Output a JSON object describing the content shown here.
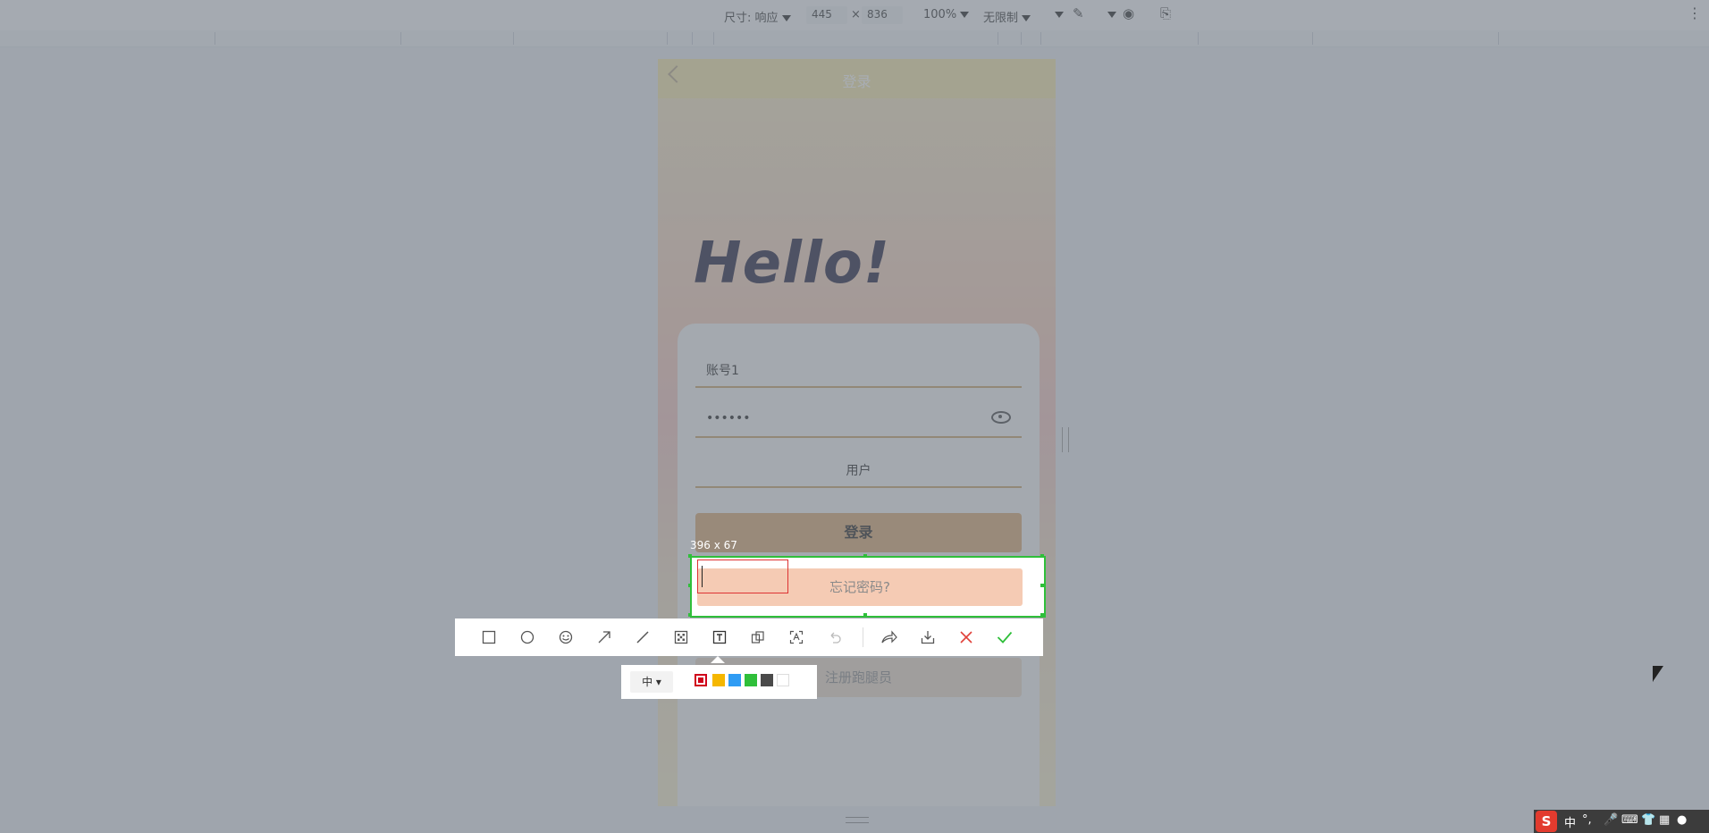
{
  "devtools": {
    "size_label": "尺寸: 响应",
    "width": "445",
    "times": "×",
    "height": "836",
    "zoom": "100%",
    "throttle": "无限制"
  },
  "app": {
    "nav_title": "登录",
    "hello": "Hello!",
    "account_value": "账号1",
    "password_value": "••••••",
    "role_value": "用户",
    "login_label": "登录",
    "forgot_label": "忘记密码?",
    "register_label": "注册跑腿员"
  },
  "capture": {
    "size_text": "396 x 67",
    "font_size_option": "中",
    "colors": [
      "#d0021b",
      "#f5b700",
      "#2f9cf4",
      "#2fbf3a",
      "#4a4a4a",
      "#ffffff"
    ]
  },
  "tools": [
    "rectangle-icon",
    "ellipse-icon",
    "emoji-icon",
    "arrow-icon",
    "line-icon",
    "mosaic-icon",
    "text-icon",
    "copy-icon",
    "ocr-icon",
    "undo-icon",
    "share-icon",
    "download-icon",
    "close-icon",
    "confirm-icon"
  ],
  "ime": {
    "logo": "S",
    "mode": "中",
    "punct": "°,"
  }
}
